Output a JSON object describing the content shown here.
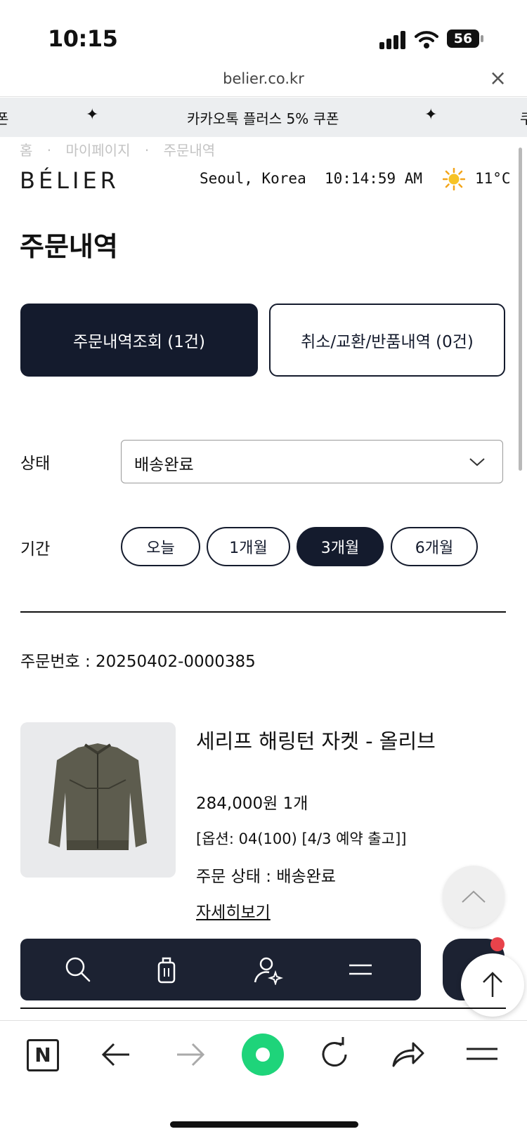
{
  "status_bar": {
    "time": "10:15",
    "battery": "56"
  },
  "browser": {
    "url": "belier.co.kr"
  },
  "promo": {
    "text": "카카오톡 플러스 5% 쿠폰",
    "left_fragment": "폰",
    "right_fragment": "쿠"
  },
  "breadcrumb": [
    "홈",
    "·",
    "마이페이지",
    "·",
    "주문내역"
  ],
  "header": {
    "logo": "BÉLIER",
    "location": "Seoul, Korea",
    "time": "10:14:59 AM",
    "temperature": "11°C",
    "weather_icon": "sun-icon"
  },
  "page_title": "주문내역",
  "tabs": [
    {
      "label": "주문내역조회 (1건)",
      "active": true
    },
    {
      "label": "취소/교환/반품내역 (0건)",
      "active": false
    }
  ],
  "filters": {
    "status_label": "상태",
    "status_value": "배송완료",
    "period_label": "기간",
    "periods": [
      {
        "label": "오늘",
        "active": false
      },
      {
        "label": "1개월",
        "active": false
      },
      {
        "label": "3개월",
        "active": true
      },
      {
        "label": "6개월",
        "active": false
      }
    ]
  },
  "order": {
    "order_number": "주문번호 : 20250402-0000385",
    "product_name": "세리프 해링턴 자켓 - 올리브",
    "price_qty": "284,000원   1개",
    "option": "[옵션: 04(100) [4/3 예약 출고]]",
    "status": "주문 상태 : 배송완료",
    "detail_link": "자세히보기"
  },
  "colors": {
    "navy": "#141b2d",
    "nav_bg": "#1c2232",
    "badge": "#e8434b",
    "accent_green": "#1ed47a"
  },
  "bottom_nav_icons": [
    "search-icon",
    "shopping-bag-icon",
    "user-star-icon",
    "menu-icon"
  ],
  "browser_toolbar_icons": [
    "naver-n-icon",
    "back-arrow-icon",
    "forward-arrow-icon",
    "naver-green-dot-icon",
    "reload-icon",
    "share-icon",
    "menu-icon"
  ]
}
